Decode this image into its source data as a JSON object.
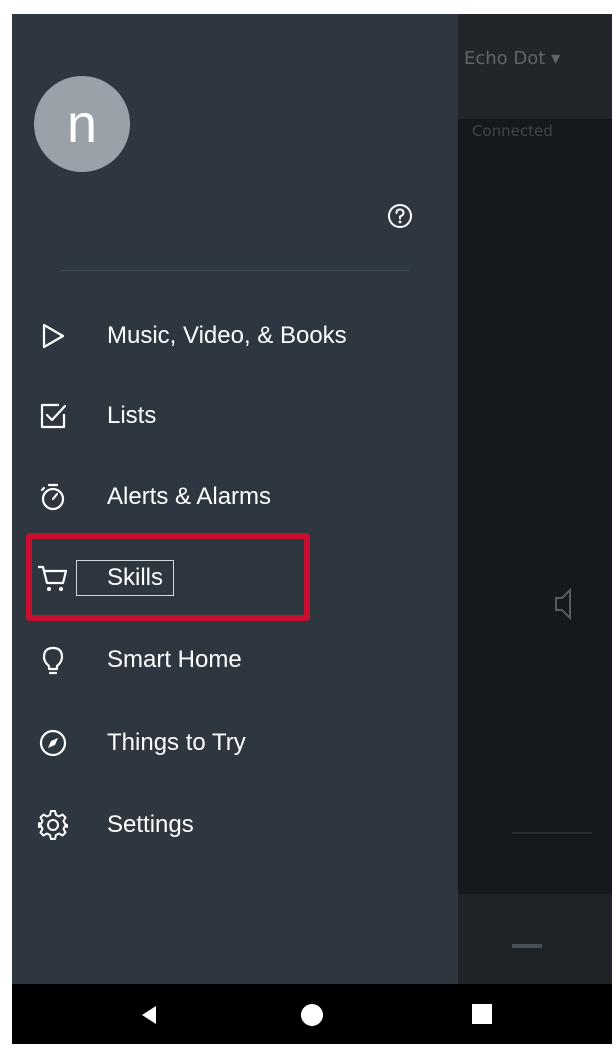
{
  "background": {
    "device_title": "Echo Dot ▾",
    "subtitle": "Connected"
  },
  "drawer": {
    "avatar_letter": "n",
    "menu": [
      {
        "label": "Music, Video, & Books",
        "icon": "play-icon"
      },
      {
        "label": "Lists",
        "icon": "checkbox-icon"
      },
      {
        "label": "Alerts & Alarms",
        "icon": "stopwatch-icon"
      },
      {
        "label": "Skills",
        "icon": "cart-icon"
      },
      {
        "label": "Smart Home",
        "icon": "lightbulb-icon"
      },
      {
        "label": "Things to Try",
        "icon": "compass-icon"
      },
      {
        "label": "Settings",
        "icon": "gear-icon"
      }
    ]
  },
  "colors": {
    "drawer_bg": "#2e3740",
    "highlight": "#c8102e",
    "text": "#ffffff"
  }
}
